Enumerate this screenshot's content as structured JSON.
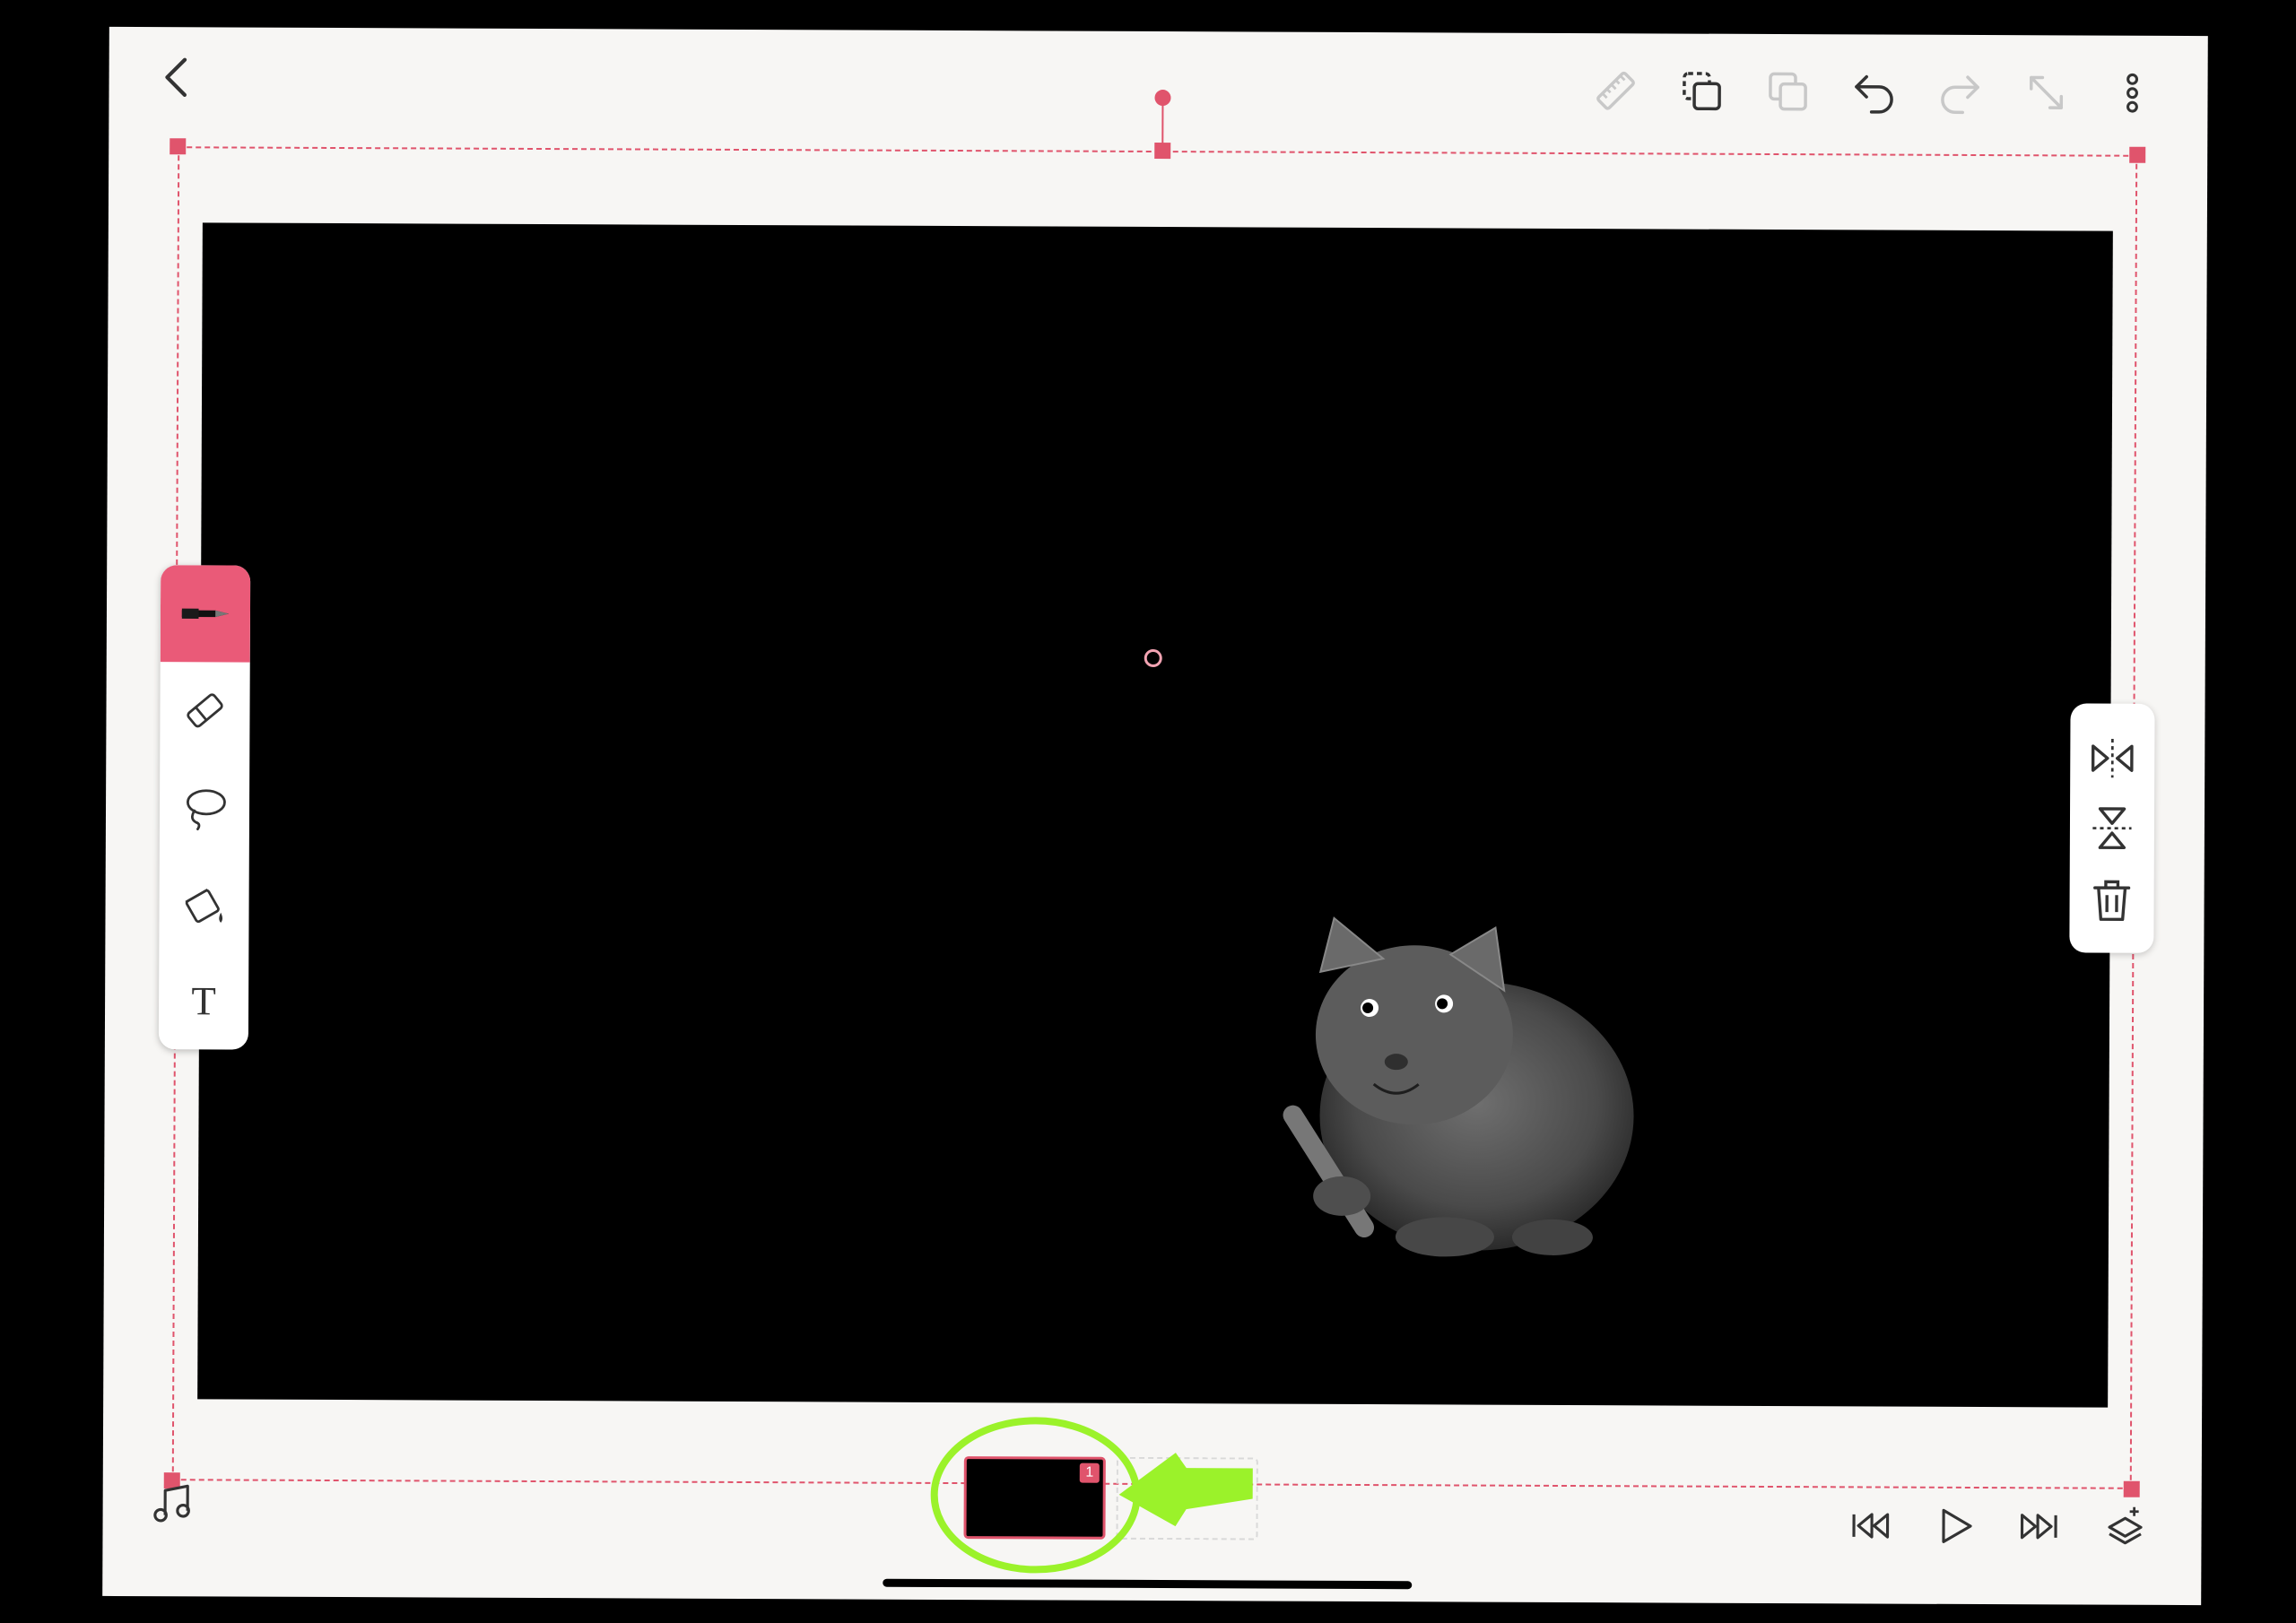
{
  "app": {
    "accent_color": "#ea5a78",
    "annotation_color": "#9bf22a"
  },
  "top_toolbar": {
    "icons": [
      "chevron-left-icon",
      "ruler-icon",
      "duplicate-icon",
      "copy-icon",
      "undo-icon",
      "redo-icon",
      "resize-icon",
      "more-icon"
    ]
  },
  "tools": {
    "items": [
      "pen-icon",
      "eraser-icon",
      "lasso-icon",
      "paint-bucket-icon",
      "text-tool-icon"
    ],
    "active": "pen-icon",
    "text_tool_glyph": "T"
  },
  "selection_tools": {
    "items": [
      "flip-horizontal-icon",
      "flip-vertical-icon",
      "trash-icon"
    ]
  },
  "timeline": {
    "frames": [
      {
        "number": "1",
        "selected": true
      }
    ],
    "empty_slot": true
  },
  "playback": {
    "icons": [
      "music-icon",
      "skip-to-start-icon",
      "play-icon",
      "skip-to-end-icon",
      "layers-icon"
    ]
  }
}
